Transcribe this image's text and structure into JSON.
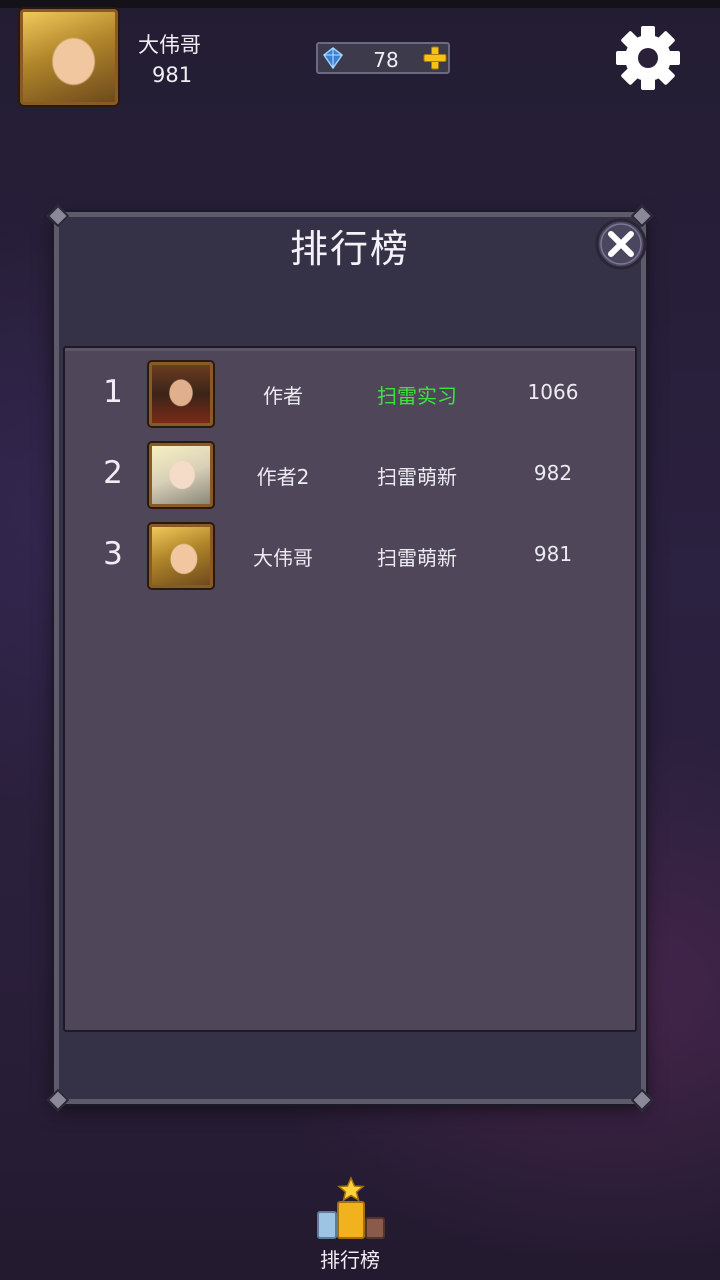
{
  "player": {
    "name": "大伟哥",
    "score": "981"
  },
  "currency": {
    "gems": "78"
  },
  "leaderboard": {
    "title": "排行榜",
    "rows": [
      {
        "rank": "1",
        "name": "作者",
        "title": "扫雷实习",
        "score": "1066"
      },
      {
        "rank": "2",
        "name": "作者2",
        "title": "扫雷萌新",
        "score": "982"
      },
      {
        "rank": "3",
        "name": "大伟哥",
        "title": "扫雷萌新",
        "score": "981"
      }
    ]
  },
  "nav": {
    "leaderboard_label": "排行榜"
  },
  "colors": {
    "panel": "#353146",
    "list_bg": "#4f4759",
    "highlight_title": "#3ee23e",
    "gold_frame": "#8a5a26"
  }
}
